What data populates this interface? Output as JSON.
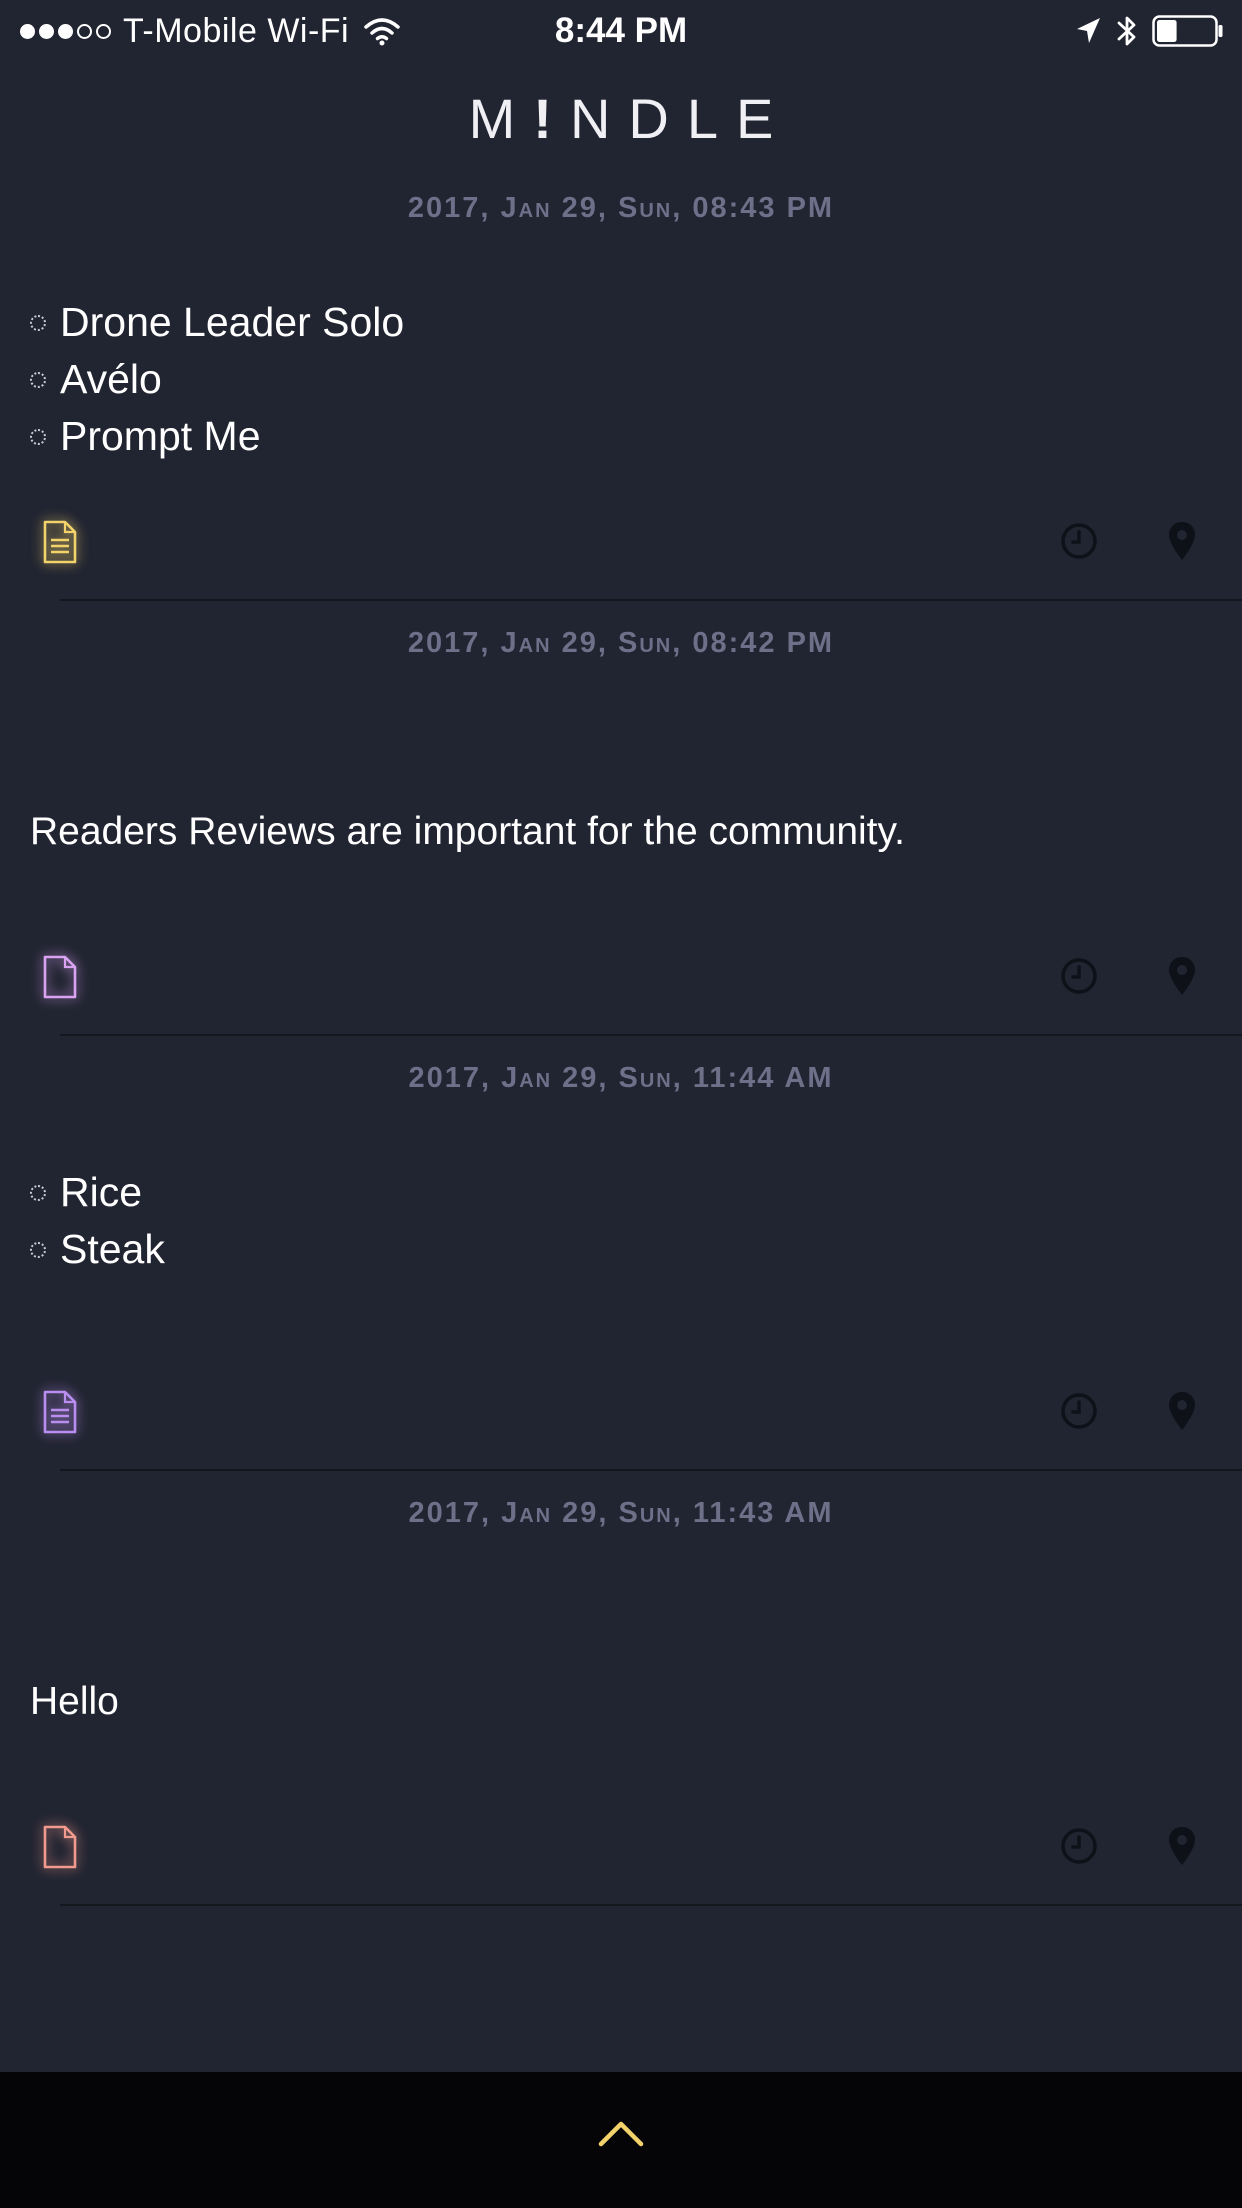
{
  "status_bar": {
    "carrier": "T-Mobile Wi-Fi",
    "time": "8:44 PM",
    "signal_bars_filled": 3,
    "signal_bars_total": 5,
    "battery_level": 0.35
  },
  "app": {
    "logo_prefix": "M",
    "logo_mark": "!",
    "logo_suffix": "NDLE"
  },
  "notes": [
    {
      "date": "2017, Jan 29, Sun, 08:43 PM",
      "kind": "checklist",
      "items": [
        "Drone Leader Solo",
        "Avélo",
        "Prompt Me"
      ],
      "icon": "document-lines-icon",
      "icon_color": "#f2d36b"
    },
    {
      "date": "2017, Jan 29, Sun, 08:42 PM",
      "kind": "text",
      "text": "Readers Reviews are important for the community.",
      "icon": "document-blank-icon",
      "icon_color": "#d9a3f2"
    },
    {
      "date": "2017, Jan 29, Sun, 11:44 AM",
      "kind": "checklist",
      "items": [
        "Rice",
        "Steak"
      ],
      "icon": "document-lines-icon",
      "icon_color": "#b98ef0"
    },
    {
      "date": "2017, Jan 29, Sun, 11:43 AM",
      "kind": "text",
      "text": "Hello",
      "icon": "document-blank-icon",
      "icon_color": "#f29a8e"
    }
  ],
  "colors": {
    "background": "#212431",
    "date_text": "#6c7088",
    "footer_icon": "#0f1118",
    "bottom_bar": "#050507",
    "accent": "#f2d36b"
  }
}
